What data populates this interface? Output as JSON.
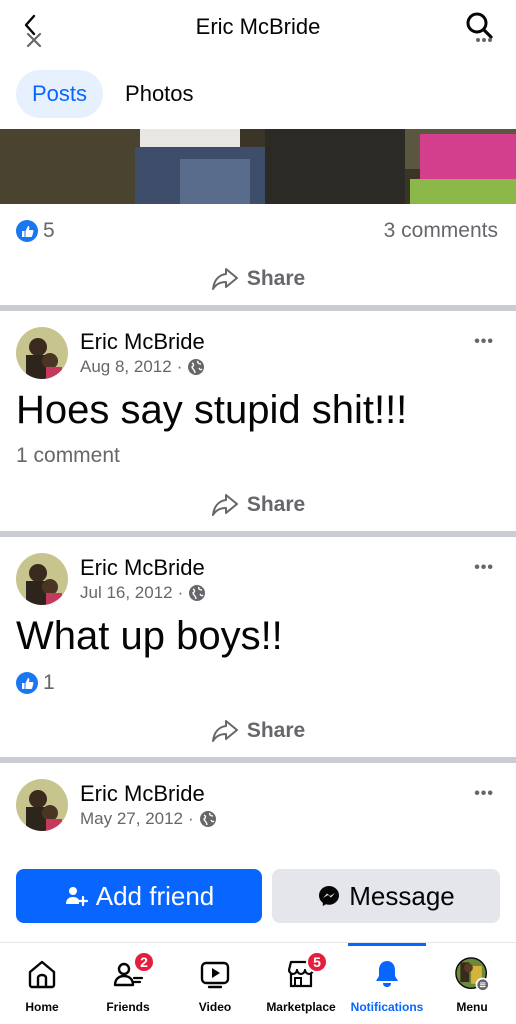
{
  "header": {
    "title": "Eric McBride"
  },
  "tabs": [
    {
      "label": "Posts"
    },
    {
      "label": "Photos"
    }
  ],
  "previous_post": {
    "likes": "5",
    "comments": "3 comments",
    "share_label": "Share"
  },
  "posts": [
    {
      "author": "Eric McBride",
      "date": "Aug 8, 2012",
      "text": "Hoes say stupid shit!!!",
      "comments": "1 comment",
      "share_label": "Share"
    },
    {
      "author": "Eric McBride",
      "date": "Jul 16, 2012",
      "text": "What up boys!!",
      "likes": "1",
      "share_label": "Share"
    },
    {
      "author": "Eric McBride",
      "date": "May 27, 2012"
    }
  ],
  "actions": {
    "add_friend": "Add friend",
    "message": "Message"
  },
  "nav": {
    "items": [
      {
        "label": "Home",
        "icon": "home-icon"
      },
      {
        "label": "Friends",
        "icon": "friends-icon",
        "badge": "2"
      },
      {
        "label": "Video",
        "icon": "video-icon"
      },
      {
        "label": "Marketplace",
        "icon": "marketplace-icon",
        "badge": "5"
      },
      {
        "label": "Notifications",
        "icon": "bell-icon"
      },
      {
        "label": "Menu",
        "icon": "menu-avatar-icon"
      }
    ]
  },
  "colors": {
    "accent": "#0866ff",
    "badge": "#e41e3f",
    "muted": "#65676b"
  }
}
